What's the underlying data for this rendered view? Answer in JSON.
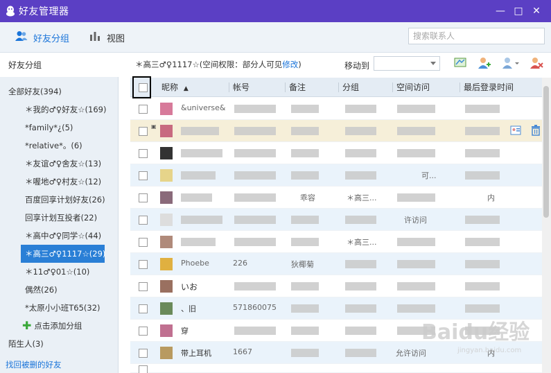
{
  "window": {
    "title": "好友管理器",
    "minimize": "—",
    "maximize": "□",
    "close": "✕"
  },
  "toolbar": {
    "friend_groups_label": "好友分组",
    "view_label": "视图",
    "search_placeholder": "搜索联系人"
  },
  "sidebar": {
    "header": "好友分组",
    "items": [
      {
        "label": "全部好友(394)",
        "level": 0
      },
      {
        "label": "＊我的♂♀好友☆(169)",
        "level": 1
      },
      {
        "label": "*family*¿(5)",
        "level": 1
      },
      {
        "label": "*relative*。(6)",
        "level": 1
      },
      {
        "label": "＊友谊♂♀舍友☆(13)",
        "level": 1
      },
      {
        "label": "＊喔地♂♀村友☆(12)",
        "level": 1
      },
      {
        "label": "百度回享计划好友(26)",
        "level": 1
      },
      {
        "label": "回享计划互投者(22)",
        "level": 1
      },
      {
        "label": "＊高中♂♀同学☆(44)",
        "level": 1
      },
      {
        "label": "＊高三♂♀1117☆(29)",
        "level": 1,
        "selected": true
      },
      {
        "label": "＊11♂♀01☆(10)",
        "level": 1
      },
      {
        "label": "偶然(26)",
        "level": 1
      },
      {
        "label": "*太原小小班T65(32)",
        "level": 1
      }
    ],
    "add_group": "点击添加分组",
    "strangers": "陌生人(3)",
    "recover": "找回被删的好友"
  },
  "main": {
    "permission_prefix": "＊高三♂♀1117☆(空间权限：部分人可见",
    "permission_link": "修改",
    "permission_suffix": ")",
    "move_to_label": "移动到",
    "move_to_value": ""
  },
  "table": {
    "columns": [
      "昵称",
      "帐号",
      "备注",
      "分组",
      "空间访问",
      "最后登录时间"
    ],
    "rows": [
      {
        "nickname": "&universe&",
        "account": "",
        "note": "",
        "group": "",
        "space": "",
        "last_login": ""
      },
      {
        "nickname": "",
        "account": "",
        "note": "",
        "group": "",
        "space": "",
        "last_login": ""
      },
      {
        "nickname": "",
        "account": "",
        "note": "",
        "group": "",
        "space": "",
        "last_login": ""
      },
      {
        "nickname": "",
        "account": "",
        "note": "",
        "group": "",
        "space": "可...",
        "last_login": ""
      },
      {
        "nickname": "",
        "account": "",
        "note": "乖容",
        "group": "＊高三...",
        "space": "",
        "last_login": "内"
      },
      {
        "nickname": "",
        "account": "",
        "note": "",
        "group": "",
        "space": "许访问",
        "last_login": ""
      },
      {
        "nickname": "",
        "account": "",
        "note": "",
        "group": "＊高三...",
        "space": "",
        "last_login": ""
      },
      {
        "nickname": "Phoebe",
        "account": "226",
        "note": "狄椰菊",
        "group": "",
        "space": "",
        "last_login": ""
      },
      {
        "nickname": "いお",
        "account": "",
        "note": "",
        "group": "",
        "space": "",
        "last_login": ""
      },
      {
        "nickname": "、旧",
        "account": "571860075",
        "note": "",
        "group": "",
        "space": "",
        "last_login": ""
      },
      {
        "nickname": "穿",
        "account": "",
        "note": "",
        "group": "",
        "space": "",
        "last_login": ""
      },
      {
        "nickname": "带上耳机",
        "account": "1667",
        "note": "",
        "group": "",
        "space": "允许访问",
        "last_login": "内"
      }
    ]
  },
  "watermark": {
    "brand": "Baidu经验",
    "url": "jingyan.baidu.com"
  },
  "colors": {
    "titlebar": "#5b3fc4",
    "accent": "#1a74d9",
    "selected": "#2a7fd6",
    "row_alt": "#eaf3fb",
    "row_hover": "#f6efd9"
  }
}
